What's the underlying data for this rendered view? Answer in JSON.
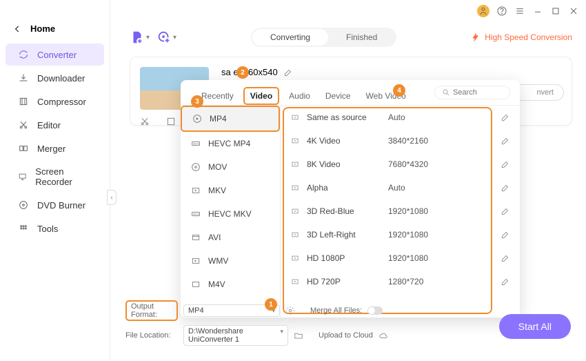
{
  "window_controls": {
    "minimize": "minimize",
    "maximize": "maximize",
    "close": "close"
  },
  "sidebar": {
    "home": "Home",
    "items": [
      {
        "label": "Converter",
        "icon": "sync"
      },
      {
        "label": "Downloader",
        "icon": "download"
      },
      {
        "label": "Compressor",
        "icon": "compress"
      },
      {
        "label": "Editor",
        "icon": "cut"
      },
      {
        "label": "Merger",
        "icon": "merge"
      },
      {
        "label": "Screen Recorder",
        "icon": "screen"
      },
      {
        "label": "DVD Burner",
        "icon": "disc"
      },
      {
        "label": "Tools",
        "icon": "grid"
      }
    ]
  },
  "tabs": {
    "converting": "Converting",
    "finished": "Finished"
  },
  "hsc": "High Speed Conversion",
  "file": {
    "title": "sa        e_960x540"
  },
  "convert_btn": "nvert",
  "dropdown": {
    "tabs": {
      "recently": "Recently",
      "video": "Video",
      "audio": "Audio",
      "device": "Device",
      "web": "Web Video"
    },
    "search_placeholder": "Search",
    "left": [
      {
        "label": "MP4"
      },
      {
        "label": "HEVC MP4"
      },
      {
        "label": "MOV"
      },
      {
        "label": "MKV"
      },
      {
        "label": "HEVC MKV"
      },
      {
        "label": "AVI"
      },
      {
        "label": "WMV"
      },
      {
        "label": "M4V"
      }
    ],
    "right": [
      {
        "name": "Same as source",
        "res": "Auto"
      },
      {
        "name": "4K Video",
        "res": "3840*2160"
      },
      {
        "name": "8K Video",
        "res": "7680*4320"
      },
      {
        "name": "Alpha",
        "res": "Auto"
      },
      {
        "name": "3D Red-Blue",
        "res": "1920*1080"
      },
      {
        "name": "3D Left-Right",
        "res": "1920*1080"
      },
      {
        "name": "HD 1080P",
        "res": "1920*1080"
      },
      {
        "name": "HD 720P",
        "res": "1280*720"
      }
    ]
  },
  "badges": {
    "b1": "1",
    "b2": "2",
    "b3": "3",
    "b4": "4"
  },
  "bottom": {
    "output_format_label": "Output Format:",
    "output_format_value": "MP4",
    "merge_label": "Merge All Files:",
    "file_location_label": "File Location:",
    "file_location_value": "D:\\Wondershare UniConverter 1",
    "upload_cloud": "Upload to Cloud"
  },
  "start_all": "Start All"
}
